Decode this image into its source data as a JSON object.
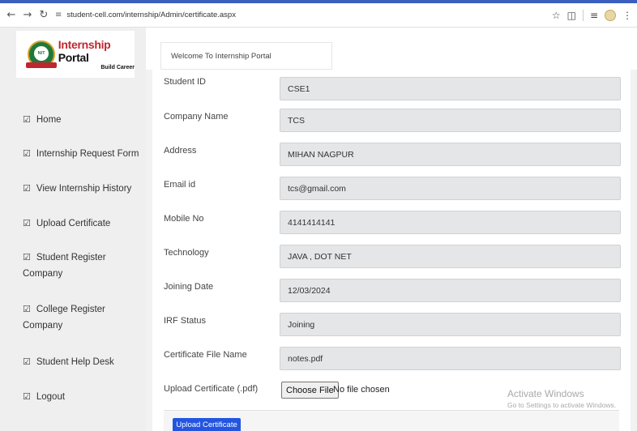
{
  "browser": {
    "url": "student-cell.com/internship/Admin/certificate.aspx",
    "icons": [
      "back-arrow",
      "forward-arrow",
      "reload",
      "site-settings",
      "bookmark-star",
      "extensions",
      "reading-list",
      "profile",
      "menu-dots"
    ]
  },
  "logo": {
    "title_part1": "Internship",
    "title_part2": " Portal",
    "subtitle": "Build Career",
    "emblem_text": "NIT"
  },
  "header": {
    "welcome": "Welcome To Internship Portal"
  },
  "sidebar": {
    "items": [
      {
        "label": "Home"
      },
      {
        "label": "Internship Request Form"
      },
      {
        "label": "View Internship History"
      },
      {
        "label": "Upload Certificate"
      },
      {
        "label": "Student Register Company"
      },
      {
        "label": "College Register Company"
      },
      {
        "label": "Student Help Desk"
      },
      {
        "label": "Logout"
      }
    ]
  },
  "form": {
    "fields": [
      {
        "label": "Student ID",
        "value": "CSE1"
      },
      {
        "label": "Company Name",
        "value": "TCS"
      },
      {
        "label": "Address",
        "value": "MIHAN NAGPUR"
      },
      {
        "label": "Email id",
        "value": "tcs@gmail.com"
      },
      {
        "label": "Mobile No",
        "value": "4141414141"
      },
      {
        "label": "Technology",
        "value": "JAVA , DOT NET"
      },
      {
        "label": "Joining Date",
        "value": "12/03/2024"
      },
      {
        "label": "IRF Status",
        "value": "Joining"
      },
      {
        "label": "Certificate File Name",
        "value": "notes.pdf"
      }
    ],
    "upload_label": "Upload Certificate (.pdf)",
    "choose_file_label": "Choose File",
    "no_file_text": "No file chosen",
    "submit_label": "Upload Certificate"
  },
  "watermark": {
    "title": "Activate Windows",
    "subtitle": "Go to Settings to activate Windows."
  },
  "colors": {
    "browser_accent": "#3a5fbf",
    "brand_red": "#c0262d",
    "emblem_green": "#1f7a3a",
    "primary_button": "#2255e0",
    "sidebar_bg": "#efefef",
    "field_bg": "#e5e6e8"
  }
}
